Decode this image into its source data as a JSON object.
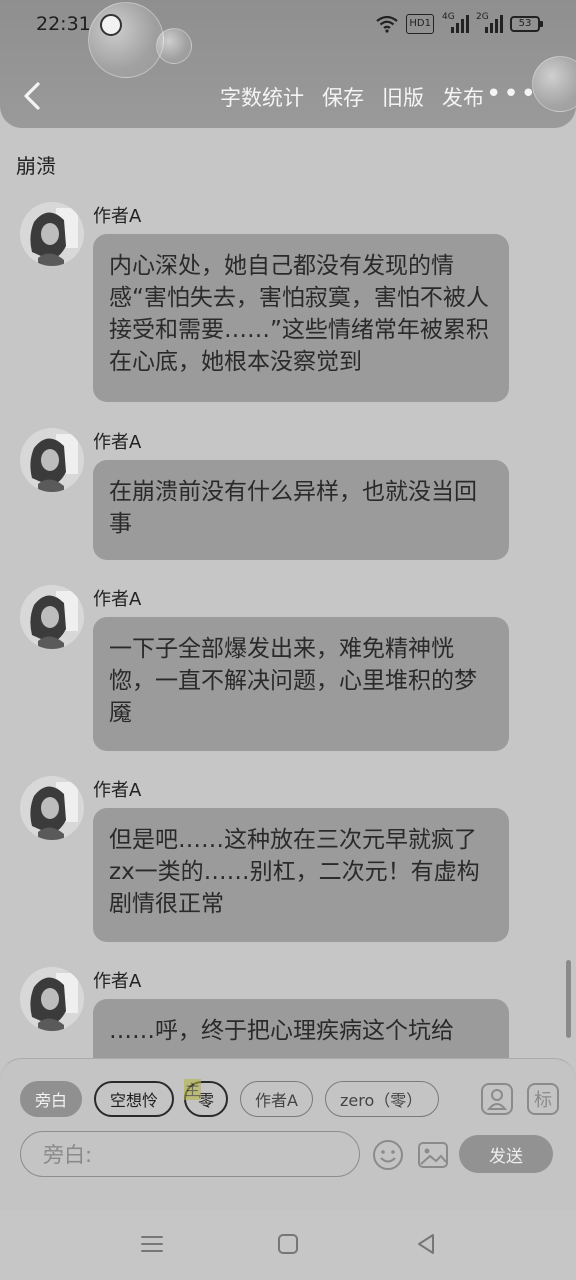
{
  "status_bar": {
    "time": "22:31",
    "hd_label": "HD1",
    "signal_1_label": "4G",
    "signal_2_label": "2G",
    "battery": "53"
  },
  "nav": {
    "actions": [
      "字数统计",
      "保存",
      "旧版",
      "发布"
    ],
    "more": "•••"
  },
  "chapter_title": "崩溃",
  "messages": [
    {
      "author": "作者A",
      "text": "内心深处，她自己都没有发现的情感“害怕失去，害怕寂寞，害怕不被人接受和需要……”这些情绪常年被累积在心底，她根本没察觉到"
    },
    {
      "author": "作者A",
      "text": "在崩溃前没有什么异样，也就没当回事"
    },
    {
      "author": "作者A",
      "text": "一下子全部爆发出来，难免精神恍惚，一直不解决问题，心里堆积的梦魇"
    },
    {
      "author": "作者A",
      "text": "但是吧……这种放在三次元早就疯了zx一类的……别杠，二次元！有虚构剧情很正常"
    },
    {
      "author": "作者A",
      "text": "……呼，终于把心理疾病这个坑给"
    }
  ],
  "panel": {
    "chips": [
      "旁白",
      "空想怜",
      "零",
      "作者A",
      "zero（零）"
    ],
    "chip_tag": "主",
    "role_icon_b": "标",
    "input_placeholder": "旁白:",
    "send_label": "发送"
  },
  "colors": {
    "background": "#c6c6c6",
    "header": "#969696",
    "bubble": "#9b9b9b",
    "send_button": "#929292"
  }
}
